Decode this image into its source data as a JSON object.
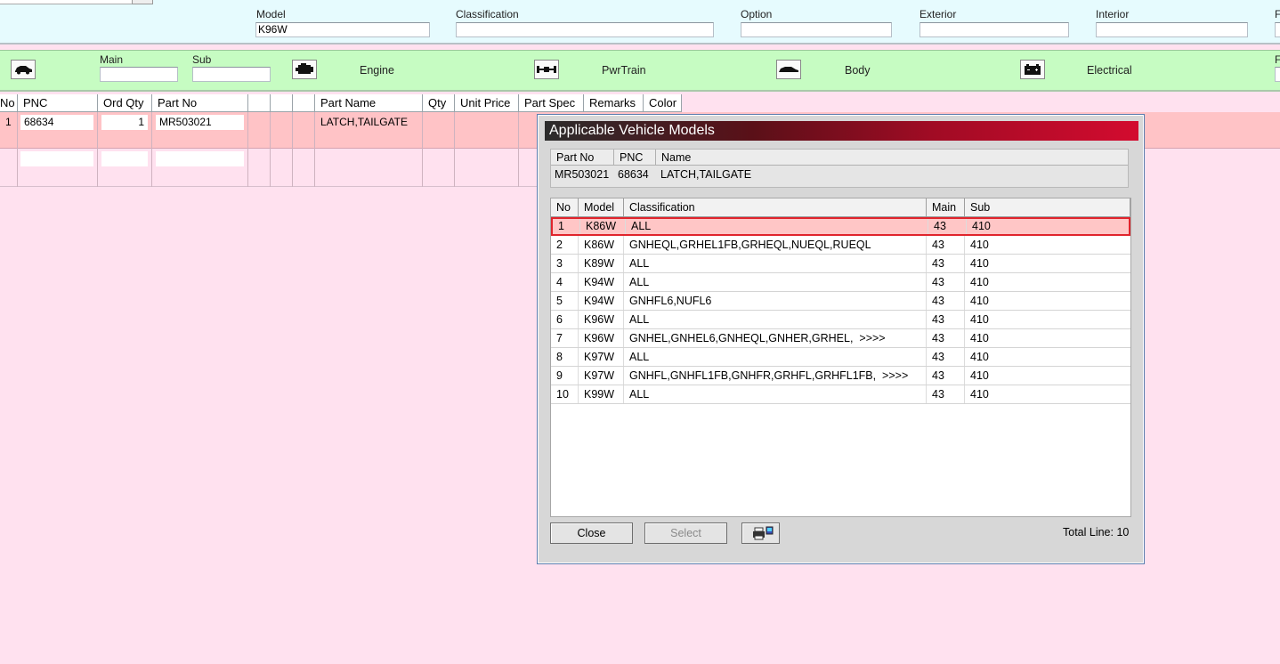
{
  "header": {
    "model_label": "Model",
    "model_value": "K96W",
    "classification_label": "Classification",
    "classification_value": "",
    "option_label": "Option",
    "option_value": "",
    "exterior_label": "Exterior",
    "exterior_value": "",
    "interior_label": "Interior",
    "interior_value": "",
    "cut_label": "F"
  },
  "category_bar": {
    "main_label": "Main",
    "main_value": "",
    "sub_label": "Sub",
    "sub_value": "",
    "categories": [
      {
        "label": "",
        "icon": "car-side-icon"
      },
      {
        "label": "Engine",
        "icon": "engine-icon"
      },
      {
        "label": "PwrTrain",
        "icon": "drivetrain-icon"
      },
      {
        "label": "Body",
        "icon": "car-body-icon"
      },
      {
        "label": "Electrical",
        "icon": "battery-icon"
      }
    ],
    "cut_label": "F"
  },
  "grid": {
    "columns": [
      "No",
      "PNC",
      "Ord Qty",
      "Part No",
      "",
      "",
      "",
      "Part Name",
      "Qty",
      "Unit Price",
      "Part Spec",
      "Remarks",
      "Color"
    ],
    "rows": [
      {
        "no": "1",
        "pnc": "68634",
        "ord_qty": "1",
        "part_no": "MR503021",
        "part_name": "LATCH,TAILGATE"
      }
    ]
  },
  "dialog": {
    "title": "Applicable Vehicle Models",
    "info_headers": [
      "Part No",
      "PNC",
      "Name"
    ],
    "info_values": {
      "part_no": "MR503021",
      "pnc": "68634",
      "name": "LATCH,TAILGATE"
    },
    "list_headers": [
      "No",
      "Model",
      "Classification",
      "Main",
      "Sub"
    ],
    "rows": [
      {
        "no": "1",
        "model": "K86W",
        "classification": "ALL",
        "main": "43",
        "sub": "410"
      },
      {
        "no": "2",
        "model": "K86W",
        "classification": "GNHEQL,GRHEL1FB,GRHEQL,NUEQL,RUEQL",
        "main": "43",
        "sub": "410"
      },
      {
        "no": "3",
        "model": "K89W",
        "classification": "ALL",
        "main": "43",
        "sub": "410"
      },
      {
        "no": "4",
        "model": "K94W",
        "classification": "ALL",
        "main": "43",
        "sub": "410"
      },
      {
        "no": "5",
        "model": "K94W",
        "classification": "GNHFL6,NUFL6",
        "main": "43",
        "sub": "410"
      },
      {
        "no": "6",
        "model": "K96W",
        "classification": "ALL",
        "main": "43",
        "sub": "410"
      },
      {
        "no": "7",
        "model": "K96W",
        "classification": "GNHEL,GNHEL6,GNHEQL,GNHER,GRHEL,  >>>>",
        "main": "43",
        "sub": "410"
      },
      {
        "no": "8",
        "model": "K97W",
        "classification": "ALL",
        "main": "43",
        "sub": "410"
      },
      {
        "no": "9",
        "model": "K97W",
        "classification": "GNHFL,GNHFL1FB,GNHFR,GRHFL,GRHFL1FB,  >>>>",
        "main": "43",
        "sub": "410"
      },
      {
        "no": "10",
        "model": "K99W",
        "classification": "ALL",
        "main": "43",
        "sub": "410"
      }
    ],
    "selected_index": 0,
    "close_label": "Close",
    "select_label": "Select",
    "print_icon": "printer-icon",
    "total_line": "Total Line: 10"
  }
}
